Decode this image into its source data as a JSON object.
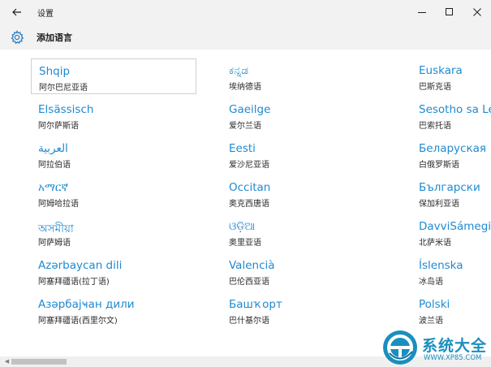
{
  "window": {
    "title": "设置",
    "controls": {
      "minimize": "—",
      "maximize": "☐",
      "close": "✕"
    }
  },
  "header": {
    "icon": "gear-icon",
    "title": "添加语言"
  },
  "languages": [
    {
      "name": "Shqip",
      "sub": "阿尔巴尼亚语"
    },
    {
      "name": "ಕನ್ನಡ",
      "sub": "埃纳德语"
    },
    {
      "name": "Euskara",
      "sub": "巴斯克语"
    },
    {
      "name": "Elsässisch",
      "sub": "阿尔萨斯语"
    },
    {
      "name": "Gaeilge",
      "sub": "爱尔兰语"
    },
    {
      "name": "Sesotho sa Le",
      "sub": "巴索托语"
    },
    {
      "name": "العربية",
      "sub": "阿拉伯语"
    },
    {
      "name": "Eesti",
      "sub": "爱沙尼亚语"
    },
    {
      "name": "Беларуская",
      "sub": "白俄罗斯语"
    },
    {
      "name": "አማርኛ",
      "sub": "阿姆哈拉语"
    },
    {
      "name": "Occitan",
      "sub": "奥克西唐语"
    },
    {
      "name": "Български",
      "sub": "保加利亚语"
    },
    {
      "name": "অসমীয়া",
      "sub": "阿萨姆语"
    },
    {
      "name": "ଓଡ଼ିଆ",
      "sub": "奥里亚语"
    },
    {
      "name": "DavviSámegi",
      "sub": "北萨米语"
    },
    {
      "name": "Azərbaycan dili",
      "sub": "阿塞拜疆语(拉丁语)"
    },
    {
      "name": "Valencià",
      "sub": "巴伦西亚语"
    },
    {
      "name": "Íslenska",
      "sub": "冰岛语"
    },
    {
      "name": "Азәрбајҹан дили",
      "sub": "阿塞拜疆语(西里尔文)"
    },
    {
      "name": "Башҡорт",
      "sub": "巴什基尔语"
    },
    {
      "name": "Polski",
      "sub": "波兰语"
    }
  ],
  "watermark": {
    "brand": "系统大全",
    "url": "WWW.XP85.COM",
    "colors": {
      "accent": "#1a8fbf",
      "accent_dark": "#0e6e9c"
    }
  },
  "colors": {
    "link": "#1f8ad1",
    "chrome": "#f2f2f2",
    "gear": "#2d7ec2"
  }
}
